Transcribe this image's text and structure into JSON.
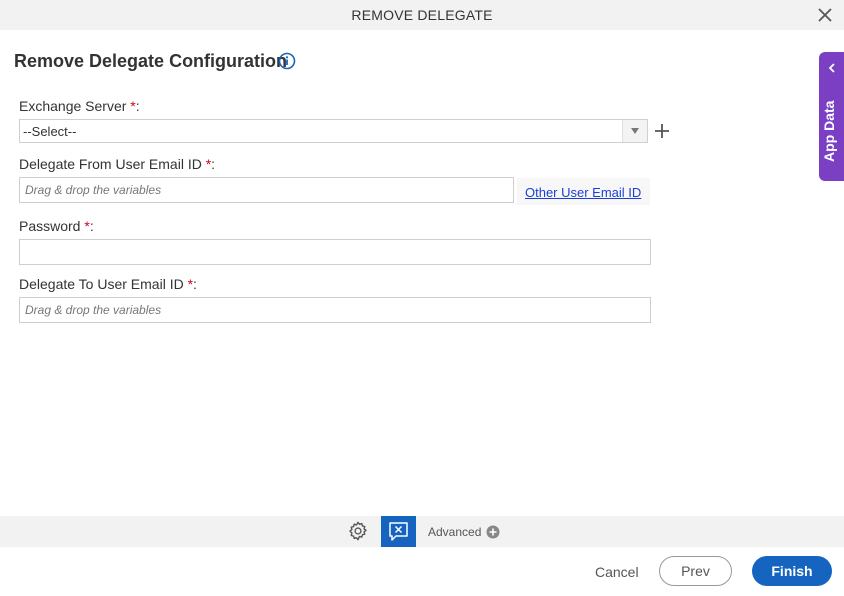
{
  "window": {
    "title": "REMOVE DELEGATE",
    "close_icon": "close-icon"
  },
  "page": {
    "heading": "Remove Delegate Configuration",
    "info_icon": "info-icon"
  },
  "form": {
    "exchange_server": {
      "label": "Exchange Server",
      "required_mark": "*",
      "suffix": ":",
      "selected": "--Select--"
    },
    "delegate_from": {
      "label": "Delegate From User Email ID",
      "required_mark": "*",
      "suffix": ":",
      "placeholder": "Drag & drop the variables",
      "link_label": "Other User Email ID"
    },
    "password": {
      "label": "Password",
      "required_mark": "*",
      "suffix": ":",
      "value": ""
    },
    "delegate_to": {
      "label": "Delegate To User Email ID",
      "required_mark": "*",
      "suffix": ":",
      "placeholder": "Drag & drop the variables"
    }
  },
  "side_panel": {
    "label": "App Data"
  },
  "toolbar": {
    "advanced_label": "Advanced"
  },
  "footer": {
    "cancel": "Cancel",
    "prev": "Prev",
    "finish": "Finish"
  },
  "colors": {
    "primary": "#1565c0",
    "side_panel": "#7b3fc4",
    "required": "#d0021b",
    "link": "#1a3fd6"
  }
}
